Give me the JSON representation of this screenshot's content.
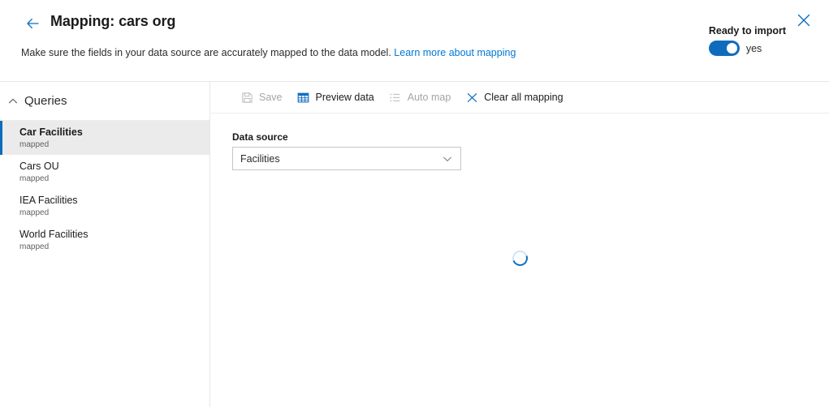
{
  "header": {
    "back_icon": "arrow-left-icon",
    "title": "Mapping: cars org",
    "subtitle_text": "Make sure the fields in your data source are accurately mapped to the data model.",
    "subtitle_link": "Learn more about mapping",
    "ready_label": "Ready to import",
    "toggle_state": "yes",
    "toggle_on": true,
    "close_icon": "close-icon"
  },
  "sidebar": {
    "section_title": "Queries",
    "collapse_icon": "chevron-up-icon",
    "items": [
      {
        "name": "Car Facilities",
        "status": "mapped",
        "selected": true
      },
      {
        "name": "Cars OU",
        "status": "mapped",
        "selected": false
      },
      {
        "name": "IEA Facilities",
        "status": "mapped",
        "selected": false
      },
      {
        "name": "World Facilities",
        "status": "mapped",
        "selected": false
      }
    ]
  },
  "toolbar": {
    "buttons": [
      {
        "label": "Save",
        "icon": "save-icon",
        "enabled": false
      },
      {
        "label": "Preview data",
        "icon": "table-grid-icon",
        "enabled": true
      },
      {
        "label": "Auto map",
        "icon": "list-icon",
        "enabled": false
      },
      {
        "label": "Clear all mapping",
        "icon": "close-x-icon",
        "enabled": true
      }
    ]
  },
  "main": {
    "data_source_label": "Data source",
    "data_source_value": "Facilities",
    "data_source_chevron": "chevron-down-icon",
    "loading": true,
    "spinner_icon": "loading-spinner-icon"
  },
  "colors": {
    "accent": "#0f6cbd",
    "link": "#0078d4",
    "selected_bg": "#ebebeb",
    "disabled_text": "#a5a5a5",
    "border": "#e6e6e6"
  }
}
